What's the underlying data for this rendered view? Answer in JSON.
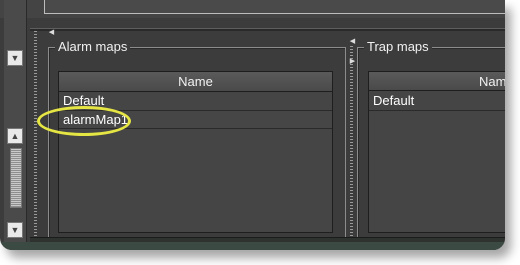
{
  "alarm_maps": {
    "title": "Alarm maps",
    "column_header": "Name",
    "rows": [
      "Default",
      "alarmMap1"
    ]
  },
  "trap_maps": {
    "title": "Trap maps",
    "column_header": "Name",
    "rows": [
      "Default"
    ]
  },
  "icons": {
    "scroll_down": "chevron-down-icon",
    "scroll_up": "chevron-up-icon",
    "splitter": "splitter-arrow-icon"
  },
  "colors": {
    "panel": "#3c3c3c",
    "highlight_ellipse": "#e5e544"
  }
}
